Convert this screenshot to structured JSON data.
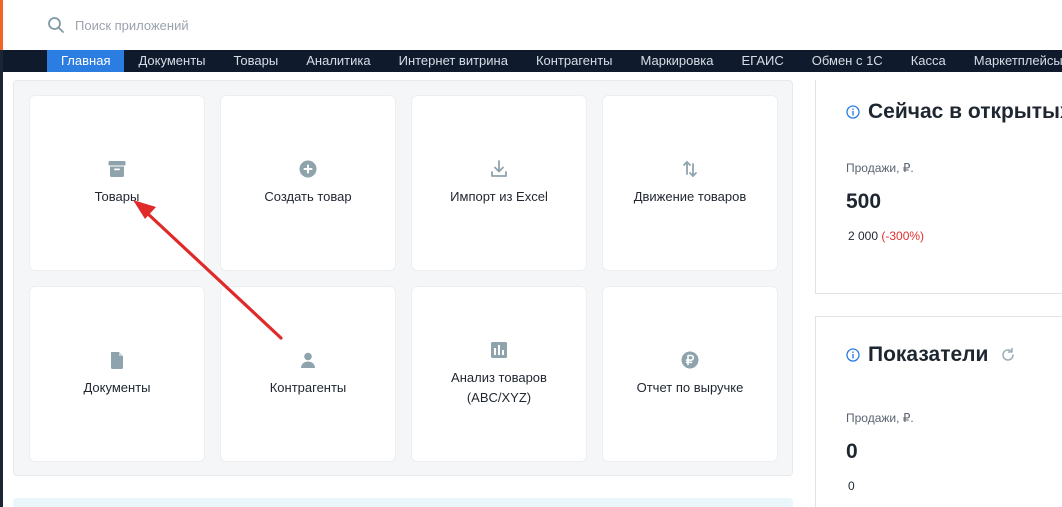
{
  "search": {
    "placeholder": "Поиск приложений"
  },
  "nav": {
    "items": [
      "Главная",
      "Документы",
      "Товары",
      "Аналитика",
      "Интернет витрина",
      "Контрагенты",
      "Маркировка",
      "ЕГАИС",
      "Обмен с 1С",
      "Касса",
      "Маркетплейсы"
    ],
    "active": 0
  },
  "tiles": [
    {
      "label": "Товары",
      "icon": "archive-box-icon"
    },
    {
      "label": "Создать товар",
      "icon": "plus-circle-icon"
    },
    {
      "label": "Импорт из Excel",
      "icon": "download-icon"
    },
    {
      "label": "Движение товаров",
      "icon": "swap-vertical-icon"
    },
    {
      "label": "Документы",
      "icon": "document-icon"
    },
    {
      "label": "Контрагенты",
      "icon": "person-icon"
    },
    {
      "label": "Анализ товаров (ABC/XYZ)",
      "icon": "bar-chart-icon"
    },
    {
      "label": "Отчет по выручке",
      "icon": "ruble-circle-icon"
    }
  ],
  "card_open": {
    "title": "Сейчас в открытых",
    "metric_label": "Продажи, ₽.",
    "value": "500",
    "previous": "2 000",
    "change": "(-300%)"
  },
  "card_indicators": {
    "title": "Показатели",
    "metric_label": "Продажи, ₽.",
    "value": "0",
    "previous": "0"
  },
  "colors": {
    "accent": "#2b7de1",
    "nav_bg": "#0f1b2d",
    "icon": "#8fa3ad",
    "annotation_arrow": "#e02a2a",
    "negative": "#e0302b"
  }
}
